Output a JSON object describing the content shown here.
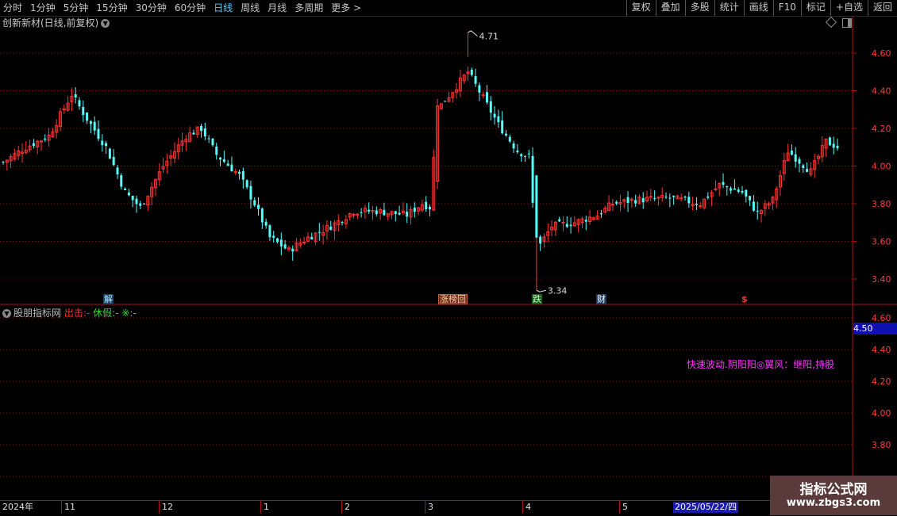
{
  "toolbar": {
    "periods": [
      "分时",
      "1分钟",
      "5分钟",
      "15分钟",
      "30分钟",
      "60分钟",
      "日线",
      "周线",
      "月线",
      "多周期",
      "更多 >"
    ],
    "active_period": "日线",
    "buttons": [
      "复权",
      "叠加",
      "多股",
      "统计",
      "画线",
      "F10",
      "标记",
      "+自选",
      "返回"
    ]
  },
  "chart": {
    "title": "创新新材(日线,前复权)",
    "price_ticks": [
      "4.60",
      "4.40",
      "4.20",
      "4.00",
      "3.80",
      "3.60",
      "3.40"
    ],
    "annotations": {
      "high": "4.71",
      "low": "3.34"
    },
    "colors": {
      "up": "#ff3232",
      "down": "#54fcfc",
      "grid": "#7a1010"
    }
  },
  "markers": {
    "jie": "解",
    "zhang": "涨榜回",
    "die": "跌",
    "cai": "财",
    "dollar": "$"
  },
  "indicator": {
    "name": "股朋指标网",
    "out_label": "出击:",
    "out_value": "-",
    "rest_label": "休假:",
    "rest_value": "-",
    "star_label": "※:",
    "star_value": "-",
    "signal_text": "快速波动.阴阳阳◎翼风：继阳,持股",
    "axis_ticks": [
      "4.60",
      "4.40",
      "4.20",
      "4.00",
      "3.80"
    ],
    "price_tag": "4.50"
  },
  "date_axis": {
    "labels": [
      "2024年",
      "11",
      "12",
      "1",
      "2",
      "3",
      "4",
      "5"
    ],
    "cursor_date": "2025/05/22/四"
  },
  "watermark": {
    "title": "指标公式网",
    "url": "www.zbgs3.com"
  }
}
